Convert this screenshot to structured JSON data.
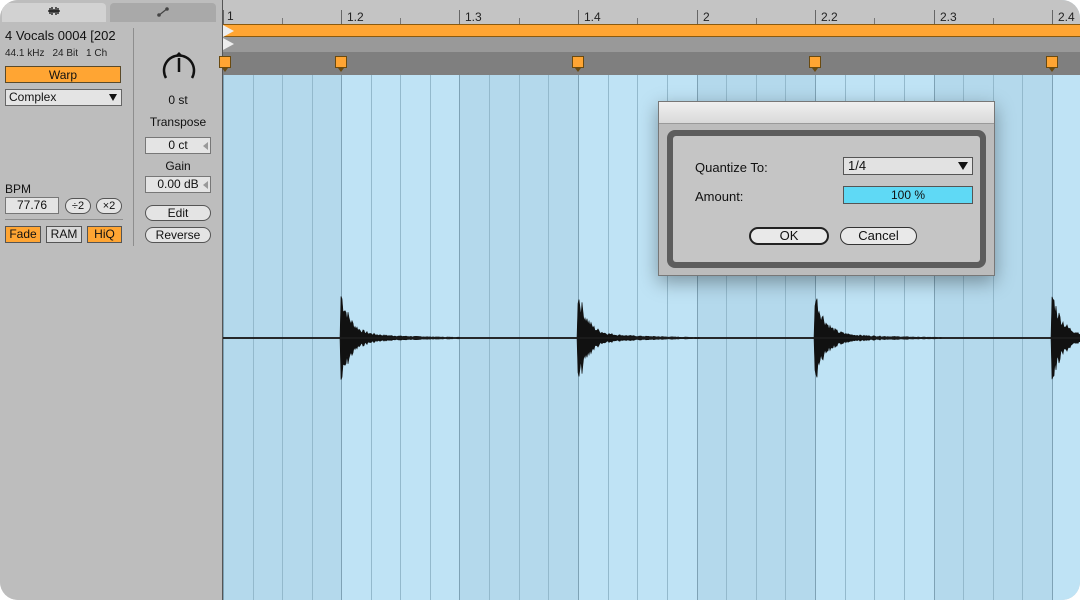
{
  "tabs": {
    "sample_icon": "waveform-tab-icon",
    "envelope_icon": "envelope-tab-icon"
  },
  "clip": {
    "name": "4 Vocals 0004 [202",
    "sample_rate": "44.1 kHz",
    "bit_depth": "24 Bit",
    "channels": "1 Ch"
  },
  "warp": {
    "button_label": "Warp",
    "mode": "Complex"
  },
  "bpm": {
    "label": "BPM",
    "value": "77.76",
    "half_label": "÷2",
    "double_label": "×2"
  },
  "toggles": {
    "fade": "Fade",
    "ram": "RAM",
    "hiq": "HiQ"
  },
  "transpose": {
    "semitones": "0 st",
    "label": "Transpose",
    "detune": "0 ct"
  },
  "gain": {
    "label": "Gain",
    "value": "0.00 dB"
  },
  "buttons": {
    "edit": "Edit",
    "reverse": "Reverse"
  },
  "ruler": {
    "labels": [
      "1",
      "1.2",
      "1.3",
      "1.4",
      "2",
      "2.2",
      "2.3",
      "2.4"
    ]
  },
  "dialog": {
    "quantize_label": "Quantize To:",
    "quantize_value": "1/4",
    "amount_label": "Amount:",
    "amount_value": "100 %",
    "ok_label": "OK",
    "cancel_label": "Cancel"
  },
  "colors": {
    "accent": "#ffa533",
    "editor_bg": "#bfe3f5",
    "amount_highlight": "#5fd9f5"
  }
}
